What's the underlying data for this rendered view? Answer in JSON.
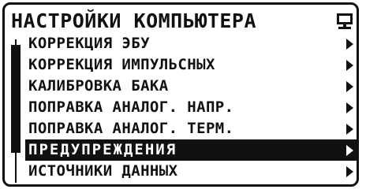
{
  "window": {
    "title": "НАСТРОЙКИ КОМПЬЮТЕРА",
    "icon": "computer-icon"
  },
  "scrollbar": {
    "position_fraction": 0.15,
    "thumb_fraction": 0.75
  },
  "menu": {
    "items": [
      {
        "label": "КОРРЕКЦИЯ ЭБУ",
        "selected": false
      },
      {
        "label": "КОРРЕКЦИЯ ИМПУЛЬСНЫХ",
        "selected": false
      },
      {
        "label": "КАЛИБРОВКА БАКА",
        "selected": false
      },
      {
        "label": "ПОПРАВКА АНАЛОГ. НАПР.",
        "selected": false
      },
      {
        "label": "ПОПРАВКА АНАЛОГ. ТЕРМ.",
        "selected": false
      },
      {
        "label": "ПРЕДУПРЕЖДЕНИЯ",
        "selected": true
      },
      {
        "label": "ИСТОЧНИКИ ДАННЫХ",
        "selected": false
      }
    ]
  },
  "colors": {
    "foreground": "#111111",
    "background": "#ffffff"
  }
}
